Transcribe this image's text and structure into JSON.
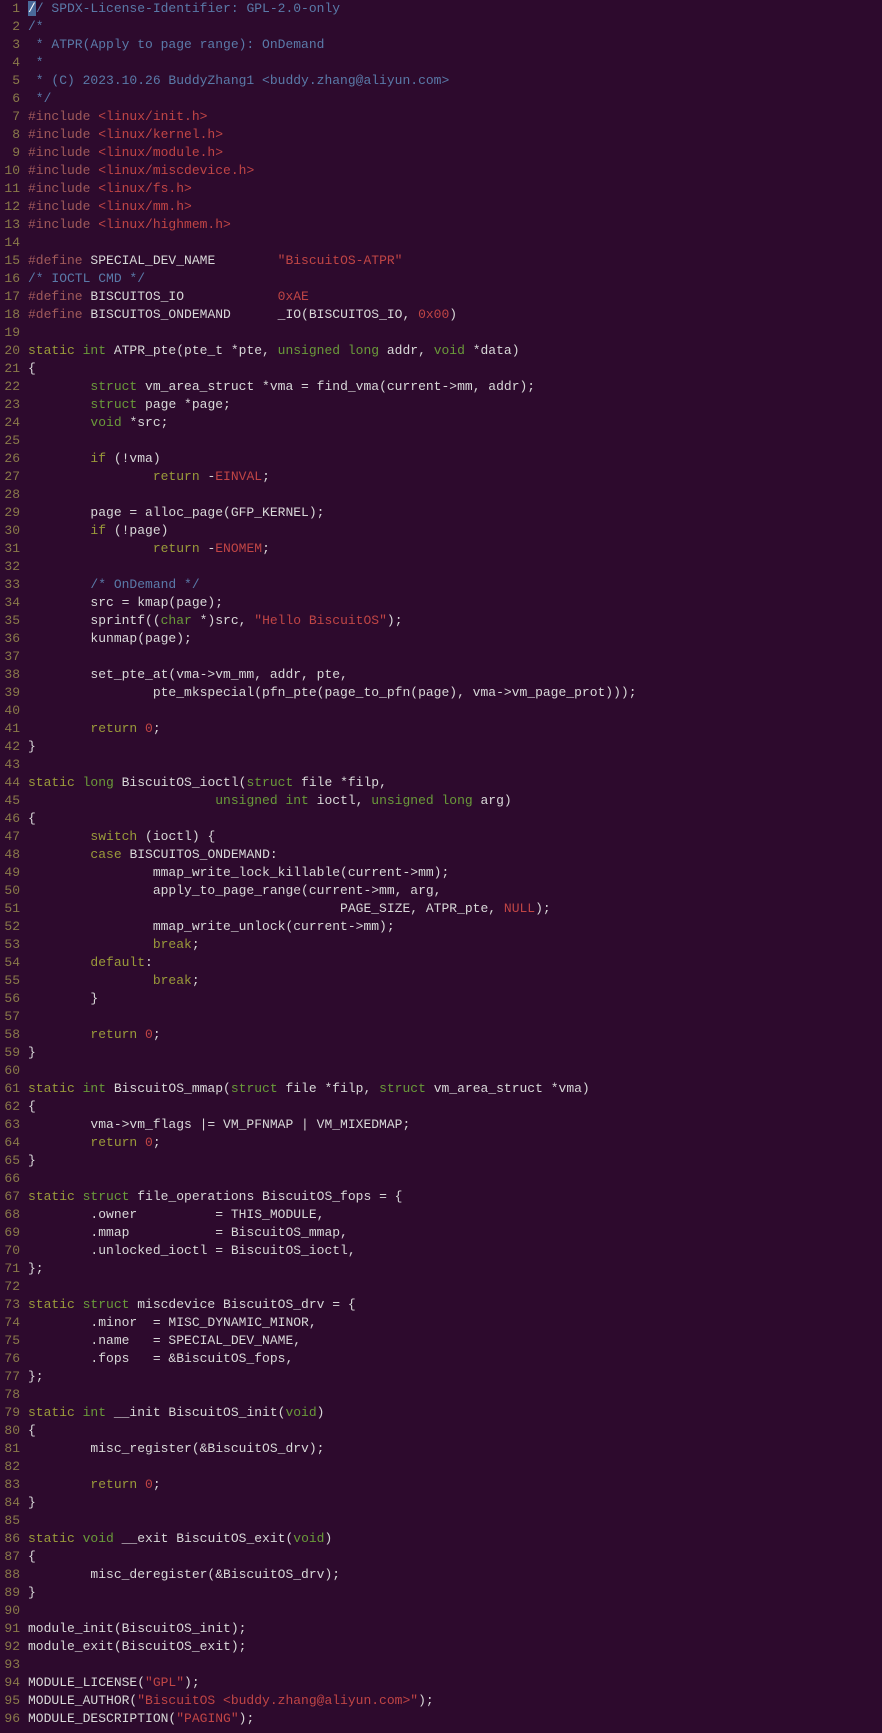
{
  "lines": [
    {
      "n": 1,
      "tokens": [
        [
          "cursor",
          "/"
        ],
        [
          "c-comment",
          "/ SPDX-License-Identifier: GPL-2.0-only"
        ]
      ]
    },
    {
      "n": 2,
      "tokens": [
        [
          "c-comment",
          "/*"
        ]
      ]
    },
    {
      "n": 3,
      "tokens": [
        [
          "c-comment",
          " * ATPR(Apply to page range): OnDemand"
        ]
      ]
    },
    {
      "n": 4,
      "tokens": [
        [
          "c-comment",
          " *"
        ]
      ]
    },
    {
      "n": 5,
      "tokens": [
        [
          "c-comment",
          " * (C) 2023.10.26 BuddyZhang1 <buddy.zhang@aliyun.com>"
        ]
      ]
    },
    {
      "n": 6,
      "tokens": [
        [
          "c-comment",
          " */"
        ]
      ]
    },
    {
      "n": 7,
      "tokens": [
        [
          "c-preproc",
          "#include "
        ],
        [
          "c-include-path",
          "<linux/init.h>"
        ]
      ]
    },
    {
      "n": 8,
      "tokens": [
        [
          "c-preproc",
          "#include "
        ],
        [
          "c-include-path",
          "<linux/kernel.h>"
        ]
      ]
    },
    {
      "n": 9,
      "tokens": [
        [
          "c-preproc",
          "#include "
        ],
        [
          "c-include-path",
          "<linux/module.h>"
        ]
      ]
    },
    {
      "n": 10,
      "tokens": [
        [
          "c-preproc",
          "#include "
        ],
        [
          "c-include-path",
          "<linux/miscdevice.h>"
        ]
      ]
    },
    {
      "n": 11,
      "tokens": [
        [
          "c-preproc",
          "#include "
        ],
        [
          "c-include-path",
          "<linux/fs.h>"
        ]
      ]
    },
    {
      "n": 12,
      "tokens": [
        [
          "c-preproc",
          "#include "
        ],
        [
          "c-include-path",
          "<linux/mm.h>"
        ]
      ]
    },
    {
      "n": 13,
      "tokens": [
        [
          "c-preproc",
          "#include "
        ],
        [
          "c-include-path",
          "<linux/highmem.h>"
        ]
      ]
    },
    {
      "n": 14,
      "tokens": []
    },
    {
      "n": 15,
      "tokens": [
        [
          "c-preproc",
          "#define "
        ],
        [
          "c-macro",
          "SPECIAL_DEV_NAME        "
        ],
        [
          "c-string",
          "\"BiscuitOS-ATPR\""
        ]
      ]
    },
    {
      "n": 16,
      "tokens": [
        [
          "c-comment",
          "/* IOCTL CMD */"
        ]
      ]
    },
    {
      "n": 17,
      "tokens": [
        [
          "c-preproc",
          "#define "
        ],
        [
          "c-macro",
          "BISCUITOS_IO            "
        ],
        [
          "c-number",
          "0xAE"
        ]
      ]
    },
    {
      "n": 18,
      "tokens": [
        [
          "c-preproc",
          "#define "
        ],
        [
          "c-macro",
          "BISCUITOS_ONDEMAND      _IO(BISCUITOS_IO, "
        ],
        [
          "c-number",
          "0x00"
        ],
        [
          "c-macro",
          ")"
        ]
      ]
    },
    {
      "n": 19,
      "tokens": []
    },
    {
      "n": 20,
      "tokens": [
        [
          "c-keyword",
          "static "
        ],
        [
          "c-type",
          "int"
        ],
        [
          "c-ident",
          " ATPR_pte(pte_t *pte, "
        ],
        [
          "c-type",
          "unsigned long"
        ],
        [
          "c-ident",
          " addr, "
        ],
        [
          "c-type",
          "void"
        ],
        [
          "c-ident",
          " *data)"
        ]
      ]
    },
    {
      "n": 21,
      "tokens": [
        [
          "c-ident",
          "{"
        ]
      ]
    },
    {
      "n": 22,
      "tokens": [
        [
          "c-ident",
          "        "
        ],
        [
          "c-type",
          "struct"
        ],
        [
          "c-ident",
          " vm_area_struct *vma = find_vma(current->mm, addr);"
        ]
      ]
    },
    {
      "n": 23,
      "tokens": [
        [
          "c-ident",
          "        "
        ],
        [
          "c-type",
          "struct"
        ],
        [
          "c-ident",
          " page *page;"
        ]
      ]
    },
    {
      "n": 24,
      "tokens": [
        [
          "c-ident",
          "        "
        ],
        [
          "c-type",
          "void"
        ],
        [
          "c-ident",
          " *src;"
        ]
      ]
    },
    {
      "n": 25,
      "tokens": []
    },
    {
      "n": 26,
      "tokens": [
        [
          "c-ident",
          "        "
        ],
        [
          "c-keyword",
          "if"
        ],
        [
          "c-ident",
          " (!vma)"
        ]
      ]
    },
    {
      "n": 27,
      "tokens": [
        [
          "c-ident",
          "                "
        ],
        [
          "c-keyword",
          "return"
        ],
        [
          "c-ident",
          " -"
        ],
        [
          "c-const",
          "EINVAL"
        ],
        [
          "c-ident",
          ";"
        ]
      ]
    },
    {
      "n": 28,
      "tokens": []
    },
    {
      "n": 29,
      "tokens": [
        [
          "c-ident",
          "        page = alloc_page(GFP_KERNEL);"
        ]
      ]
    },
    {
      "n": 30,
      "tokens": [
        [
          "c-ident",
          "        "
        ],
        [
          "c-keyword",
          "if"
        ],
        [
          "c-ident",
          " (!page)"
        ]
      ]
    },
    {
      "n": 31,
      "tokens": [
        [
          "c-ident",
          "                "
        ],
        [
          "c-keyword",
          "return"
        ],
        [
          "c-ident",
          " -"
        ],
        [
          "c-const",
          "ENOMEM"
        ],
        [
          "c-ident",
          ";"
        ]
      ]
    },
    {
      "n": 32,
      "tokens": []
    },
    {
      "n": 33,
      "tokens": [
        [
          "c-ident",
          "        "
        ],
        [
          "c-comment",
          "/* OnDemand */"
        ]
      ]
    },
    {
      "n": 34,
      "tokens": [
        [
          "c-ident",
          "        src = kmap(page);"
        ]
      ]
    },
    {
      "n": 35,
      "tokens": [
        [
          "c-ident",
          "        sprintf(("
        ],
        [
          "c-type",
          "char"
        ],
        [
          "c-ident",
          " *)src, "
        ],
        [
          "c-string",
          "\"Hello BiscuitOS\""
        ],
        [
          "c-ident",
          ");"
        ]
      ]
    },
    {
      "n": 36,
      "tokens": [
        [
          "c-ident",
          "        kunmap(page);"
        ]
      ]
    },
    {
      "n": 37,
      "tokens": []
    },
    {
      "n": 38,
      "tokens": [
        [
          "c-ident",
          "        set_pte_at(vma->vm_mm, addr, pte,"
        ]
      ]
    },
    {
      "n": 39,
      "tokens": [
        [
          "c-ident",
          "                pte_mkspecial(pfn_pte(page_to_pfn(page), vma->vm_page_prot)));"
        ]
      ]
    },
    {
      "n": 40,
      "tokens": []
    },
    {
      "n": 41,
      "tokens": [
        [
          "c-ident",
          "        "
        ],
        [
          "c-keyword",
          "return"
        ],
        [
          "c-ident",
          " "
        ],
        [
          "c-number",
          "0"
        ],
        [
          "c-ident",
          ";"
        ]
      ]
    },
    {
      "n": 42,
      "tokens": [
        [
          "c-ident",
          "}"
        ]
      ]
    },
    {
      "n": 43,
      "tokens": []
    },
    {
      "n": 44,
      "tokens": [
        [
          "c-keyword",
          "static "
        ],
        [
          "c-type",
          "long"
        ],
        [
          "c-ident",
          " BiscuitOS_ioctl("
        ],
        [
          "c-type",
          "struct"
        ],
        [
          "c-ident",
          " file *filp,"
        ]
      ]
    },
    {
      "n": 45,
      "tokens": [
        [
          "c-ident",
          "                        "
        ],
        [
          "c-type",
          "unsigned int"
        ],
        [
          "c-ident",
          " ioctl, "
        ],
        [
          "c-type",
          "unsigned long"
        ],
        [
          "c-ident",
          " arg)"
        ]
      ]
    },
    {
      "n": 46,
      "tokens": [
        [
          "c-ident",
          "{"
        ]
      ]
    },
    {
      "n": 47,
      "tokens": [
        [
          "c-ident",
          "        "
        ],
        [
          "c-keyword",
          "switch"
        ],
        [
          "c-ident",
          " (ioctl) {"
        ]
      ]
    },
    {
      "n": 48,
      "tokens": [
        [
          "c-ident",
          "        "
        ],
        [
          "c-keyword",
          "case"
        ],
        [
          "c-ident",
          " BISCUITOS_ONDEMAND:"
        ]
      ]
    },
    {
      "n": 49,
      "tokens": [
        [
          "c-ident",
          "                mmap_write_lock_killable(current->mm);"
        ]
      ]
    },
    {
      "n": 50,
      "tokens": [
        [
          "c-ident",
          "                apply_to_page_range(current->mm, arg,"
        ]
      ]
    },
    {
      "n": 51,
      "tokens": [
        [
          "c-ident",
          "                                        PAGE_SIZE, ATPR_pte, "
        ],
        [
          "c-const",
          "NULL"
        ],
        [
          "c-ident",
          ");"
        ]
      ]
    },
    {
      "n": 52,
      "tokens": [
        [
          "c-ident",
          "                mmap_write_unlock(current->mm);"
        ]
      ]
    },
    {
      "n": 53,
      "tokens": [
        [
          "c-ident",
          "                "
        ],
        [
          "c-keyword",
          "break"
        ],
        [
          "c-ident",
          ";"
        ]
      ]
    },
    {
      "n": 54,
      "tokens": [
        [
          "c-ident",
          "        "
        ],
        [
          "c-keyword",
          "default"
        ],
        [
          "c-ident",
          ":"
        ]
      ]
    },
    {
      "n": 55,
      "tokens": [
        [
          "c-ident",
          "                "
        ],
        [
          "c-keyword",
          "break"
        ],
        [
          "c-ident",
          ";"
        ]
      ]
    },
    {
      "n": 56,
      "tokens": [
        [
          "c-ident",
          "        }"
        ]
      ]
    },
    {
      "n": 57,
      "tokens": []
    },
    {
      "n": 58,
      "tokens": [
        [
          "c-ident",
          "        "
        ],
        [
          "c-keyword",
          "return"
        ],
        [
          "c-ident",
          " "
        ],
        [
          "c-number",
          "0"
        ],
        [
          "c-ident",
          ";"
        ]
      ]
    },
    {
      "n": 59,
      "tokens": [
        [
          "c-ident",
          "}"
        ]
      ]
    },
    {
      "n": 60,
      "tokens": []
    },
    {
      "n": 61,
      "tokens": [
        [
          "c-keyword",
          "static "
        ],
        [
          "c-type",
          "int"
        ],
        [
          "c-ident",
          " BiscuitOS_mmap("
        ],
        [
          "c-type",
          "struct"
        ],
        [
          "c-ident",
          " file *filp, "
        ],
        [
          "c-type",
          "struct"
        ],
        [
          "c-ident",
          " vm_area_struct *vma)"
        ]
      ]
    },
    {
      "n": 62,
      "tokens": [
        [
          "c-ident",
          "{"
        ]
      ]
    },
    {
      "n": 63,
      "tokens": [
        [
          "c-ident",
          "        vma->vm_flags |= VM_PFNMAP | VM_MIXEDMAP;"
        ]
      ]
    },
    {
      "n": 64,
      "tokens": [
        [
          "c-ident",
          "        "
        ],
        [
          "c-keyword",
          "return"
        ],
        [
          "c-ident",
          " "
        ],
        [
          "c-number",
          "0"
        ],
        [
          "c-ident",
          ";"
        ]
      ]
    },
    {
      "n": 65,
      "tokens": [
        [
          "c-ident",
          "}"
        ]
      ]
    },
    {
      "n": 66,
      "tokens": []
    },
    {
      "n": 67,
      "tokens": [
        [
          "c-keyword",
          "static "
        ],
        [
          "c-type",
          "struct"
        ],
        [
          "c-ident",
          " file_operations BiscuitOS_fops = {"
        ]
      ]
    },
    {
      "n": 68,
      "tokens": [
        [
          "c-ident",
          "        .owner          = THIS_MODULE,"
        ]
      ]
    },
    {
      "n": 69,
      "tokens": [
        [
          "c-ident",
          "        .mmap           = BiscuitOS_mmap,"
        ]
      ]
    },
    {
      "n": 70,
      "tokens": [
        [
          "c-ident",
          "        .unlocked_ioctl = BiscuitOS_ioctl,"
        ]
      ]
    },
    {
      "n": 71,
      "tokens": [
        [
          "c-ident",
          "};"
        ]
      ]
    },
    {
      "n": 72,
      "tokens": []
    },
    {
      "n": 73,
      "tokens": [
        [
          "c-keyword",
          "static "
        ],
        [
          "c-type",
          "struct"
        ],
        [
          "c-ident",
          " miscdevice BiscuitOS_drv = {"
        ]
      ]
    },
    {
      "n": 74,
      "tokens": [
        [
          "c-ident",
          "        .minor  = MISC_DYNAMIC_MINOR,"
        ]
      ]
    },
    {
      "n": 75,
      "tokens": [
        [
          "c-ident",
          "        .name   = SPECIAL_DEV_NAME,"
        ]
      ]
    },
    {
      "n": 76,
      "tokens": [
        [
          "c-ident",
          "        .fops   = &BiscuitOS_fops,"
        ]
      ]
    },
    {
      "n": 77,
      "tokens": [
        [
          "c-ident",
          "};"
        ]
      ]
    },
    {
      "n": 78,
      "tokens": []
    },
    {
      "n": 79,
      "tokens": [
        [
          "c-keyword",
          "static "
        ],
        [
          "c-type",
          "int"
        ],
        [
          "c-ident",
          " __init BiscuitOS_init("
        ],
        [
          "c-type",
          "void"
        ],
        [
          "c-ident",
          ")"
        ]
      ]
    },
    {
      "n": 80,
      "tokens": [
        [
          "c-ident",
          "{"
        ]
      ]
    },
    {
      "n": 81,
      "tokens": [
        [
          "c-ident",
          "        misc_register(&BiscuitOS_drv);"
        ]
      ]
    },
    {
      "n": 82,
      "tokens": []
    },
    {
      "n": 83,
      "tokens": [
        [
          "c-ident",
          "        "
        ],
        [
          "c-keyword",
          "return"
        ],
        [
          "c-ident",
          " "
        ],
        [
          "c-number",
          "0"
        ],
        [
          "c-ident",
          ";"
        ]
      ]
    },
    {
      "n": 84,
      "tokens": [
        [
          "c-ident",
          "}"
        ]
      ]
    },
    {
      "n": 85,
      "tokens": []
    },
    {
      "n": 86,
      "tokens": [
        [
          "c-keyword",
          "static "
        ],
        [
          "c-type",
          "void"
        ],
        [
          "c-ident",
          " __exit BiscuitOS_exit("
        ],
        [
          "c-type",
          "void"
        ],
        [
          "c-ident",
          ")"
        ]
      ]
    },
    {
      "n": 87,
      "tokens": [
        [
          "c-ident",
          "{"
        ]
      ]
    },
    {
      "n": 88,
      "tokens": [
        [
          "c-ident",
          "        misc_deregister(&BiscuitOS_drv);"
        ]
      ]
    },
    {
      "n": 89,
      "tokens": [
        [
          "c-ident",
          "}"
        ]
      ]
    },
    {
      "n": 90,
      "tokens": []
    },
    {
      "n": 91,
      "tokens": [
        [
          "c-ident",
          "module_init(BiscuitOS_init);"
        ]
      ]
    },
    {
      "n": 92,
      "tokens": [
        [
          "c-ident",
          "module_exit(BiscuitOS_exit);"
        ]
      ]
    },
    {
      "n": 93,
      "tokens": []
    },
    {
      "n": 94,
      "tokens": [
        [
          "c-ident",
          "MODULE_LICENSE("
        ],
        [
          "c-string",
          "\"GPL\""
        ],
        [
          "c-ident",
          ");"
        ]
      ]
    },
    {
      "n": 95,
      "tokens": [
        [
          "c-ident",
          "MODULE_AUTHOR("
        ],
        [
          "c-string",
          "\"BiscuitOS <buddy.zhang@aliyun.com>\""
        ],
        [
          "c-ident",
          ");"
        ]
      ]
    },
    {
      "n": 96,
      "tokens": [
        [
          "c-ident",
          "MODULE_DESCRIPTION("
        ],
        [
          "c-string",
          "\"PAGING\""
        ],
        [
          "c-ident",
          ");"
        ]
      ]
    }
  ]
}
